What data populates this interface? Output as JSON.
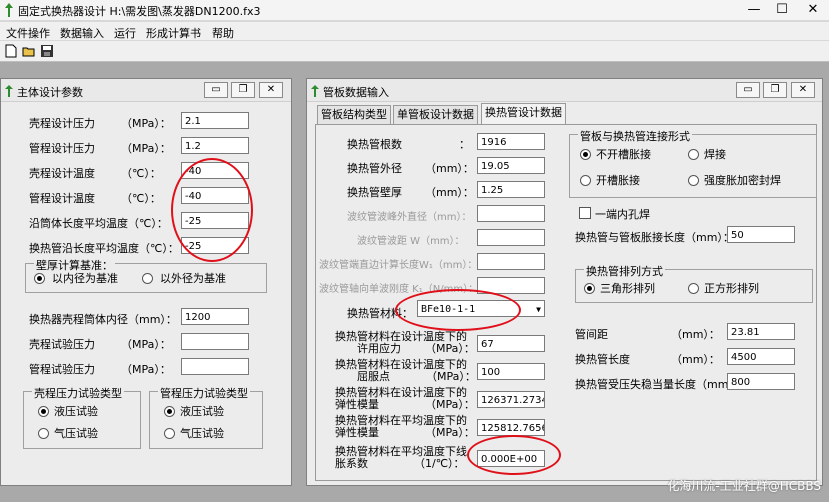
{
  "window": {
    "title": "固定式换热器设计 H:\\需发图\\蒸发器DN1200.fx3",
    "min": "—",
    "max": "☐",
    "close": "✕"
  },
  "menu": [
    "文件操作",
    "数据输入",
    "运行",
    "形成计算书",
    "帮助"
  ],
  "toolbar": {
    "icons": [
      "new-file-icon",
      "open-folder-icon",
      "save-icon"
    ]
  },
  "left_panel": {
    "title": "主体设计参数",
    "fields": [
      {
        "label": "壳程设计压力",
        "unit": "（MPa）：",
        "value": "2.1"
      },
      {
        "label": "管程设计压力",
        "unit": "（MPa）：",
        "value": "1.2"
      },
      {
        "label": "壳程设计温度",
        "unit": "（℃）：",
        "value": "-40"
      },
      {
        "label": "管程设计温度",
        "unit": "（℃）：",
        "value": "-40"
      },
      {
        "label": "沿筒体长度平均温度（℃）：",
        "unit": "",
        "value": "-25"
      },
      {
        "label": "换热管沿长度平均温度（℃）：",
        "unit": "",
        "value": "-25"
      }
    ],
    "basis_group": {
      "title": "壁厚计算基准：",
      "options": [
        "以内径为基准",
        "以外径为基准"
      ],
      "selected": 0
    },
    "fields2": [
      {
        "label": "换热器壳程筒体内径（mm）：",
        "value": "1200"
      },
      {
        "label": "壳程试验压力",
        "unit": "（MPa）：",
        "value": ""
      },
      {
        "label": "管程试验压力",
        "unit": "（MPa）：",
        "value": ""
      }
    ],
    "shell_test": {
      "title": "壳程压力试验类型",
      "options": [
        "液压试验",
        "气压试验"
      ],
      "selected": 0
    },
    "tube_test": {
      "title": "管程压力试验类型",
      "options": [
        "液压试验",
        "气压试验"
      ],
      "selected": 0
    }
  },
  "right_panel": {
    "title": "管板数据输入",
    "tabs": [
      "管板结构类型",
      "单管板设计数据",
      "换热管设计数据"
    ],
    "active_tab": 2,
    "fields": [
      {
        "label": "换热管根数",
        "unit": "：",
        "value": "1916",
        "dim": false
      },
      {
        "label": "换热管外径",
        "unit": "（mm）：",
        "value": "19.05",
        "dim": false
      },
      {
        "label": "换热管壁厚",
        "unit": "（mm）：",
        "value": "1.25",
        "dim": false
      },
      {
        "label": "波纹管波峰外直径（mm）：",
        "unit": "",
        "value": "",
        "dim": true
      },
      {
        "label": "波纹管波距  W（mm）：",
        "unit": "",
        "value": "",
        "dim": true
      },
      {
        "label": "波纹管端直边计算长度W₁（mm）：",
        "unit": "",
        "value": "",
        "dim": true
      },
      {
        "label": "波纹管轴向单波刚度 K₁（N/mm）：",
        "unit": "",
        "value": "",
        "dim": true
      }
    ],
    "material": {
      "label": "换热管材料：",
      "value": "BFe10-1-1",
      "arrow": "▼"
    },
    "props": [
      {
        "line1": "换热管材料在设计温度下的",
        "line2": "许用应力",
        "unit": "（MPa）：",
        "value": "67"
      },
      {
        "line1": "换热管材料在设计温度下的",
        "line2": "屈服点",
        "unit": "（MPa）：",
        "value": "100"
      },
      {
        "line1": "换热管材料在设计温度下的",
        "line2": "弹性模量",
        "unit": "（MPa）：",
        "value": "126371.2734"
      },
      {
        "line1": "换热管材料在平均温度下的",
        "line2": "弹性模量",
        "unit": "（MPa）：",
        "value": "125812.7656"
      },
      {
        "line1": "换热管材料在平均温度下线",
        "line2": "胀系数",
        "unit": "（1/℃）：",
        "value": "0.000E+00"
      }
    ],
    "joint_group": {
      "title": "管板与换热管连接形式",
      "options": [
        "不开槽胀接",
        "焊接",
        "开槽胀接",
        "强度胀加密封焊"
      ],
      "selected": 0
    },
    "one_end_hole": "一端内孔焊",
    "expand_length": {
      "label": "换热管与管板胀接长度（mm）：",
      "value": "50"
    },
    "layout_group": {
      "title": "换热管排列方式",
      "options": [
        "三角形排列",
        "正方形排列"
      ],
      "selected": 0
    },
    "right_fields": [
      {
        "label": "管间距",
        "unit": "（mm）：",
        "value": "23.81"
      },
      {
        "label": "换热管长度",
        "unit": "（mm）：",
        "value": "4500"
      },
      {
        "label": "换热管受压失稳当量长度（mm）：",
        "unit": "",
        "value": "800"
      }
    ]
  },
  "watermark": "化海川流-工业社群@HCBBS",
  "colors": {
    "annotation": "#e0101a",
    "workspace": "#a9a9a9",
    "panel": "#ececec"
  }
}
